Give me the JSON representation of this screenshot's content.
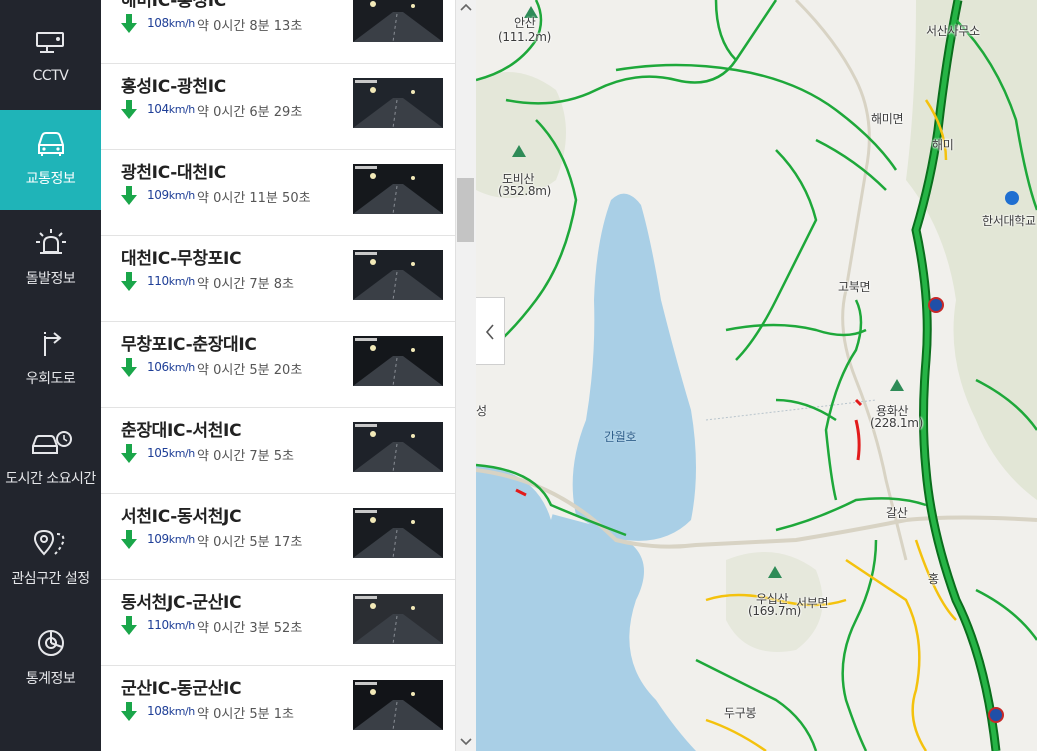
{
  "nav": {
    "items": [
      {
        "label": "CCTV",
        "icon": "cctv-icon",
        "active": false
      },
      {
        "label": "교통정보",
        "icon": "car-icon",
        "active": true
      },
      {
        "label": "돌발정보",
        "icon": "alert-siren-icon",
        "active": false
      },
      {
        "label": "우회도로",
        "icon": "detour-icon",
        "active": false
      },
      {
        "label": "도시간 소요시간",
        "icon": "car-clock-icon",
        "active": false
      },
      {
        "label": "관심구간 설정",
        "icon": "location-pin-icon",
        "active": false
      },
      {
        "label": "통계정보",
        "icon": "statistics-icon",
        "active": false
      }
    ]
  },
  "segments": [
    {
      "name": "해미IC-홍성IC",
      "speed": "108",
      "unit": "km/h",
      "time": "약 0시간 8분 13초"
    },
    {
      "name": "홍성IC-광천IC",
      "speed": "104",
      "unit": "km/h",
      "time": "약 0시간 6분 29초"
    },
    {
      "name": "광천IC-대천IC",
      "speed": "109",
      "unit": "km/h",
      "time": "약 0시간 11분 50초"
    },
    {
      "name": "대천IC-무창포IC",
      "speed": "110",
      "unit": "km/h",
      "time": "약 0시간 7분 8초"
    },
    {
      "name": "무창포IC-춘장대IC",
      "speed": "106",
      "unit": "km/h",
      "time": "약 0시간 5분 20초"
    },
    {
      "name": "춘장대IC-서천IC",
      "speed": "105",
      "unit": "km/h",
      "time": "약 0시간 7분 5초"
    },
    {
      "name": "서천IC-동서천JC",
      "speed": "109",
      "unit": "km/h",
      "time": "약 0시간 5분 17초"
    },
    {
      "name": "동서천JC-군산IC",
      "speed": "110",
      "unit": "km/h",
      "time": "약 0시간 3분 52초"
    },
    {
      "name": "군산IC-동군산IC",
      "speed": "108",
      "unit": "km/h",
      "time": "약 0시간 5분 1초"
    }
  ],
  "map": {
    "labels": {
      "ansan": "안산",
      "ansan_height": "(111.2m)",
      "dobisan": "도비산",
      "dobisan_height": "(352.8m)",
      "ganwolho": "간월호",
      "seosan_office": "서산사무소",
      "haemi": "해미면",
      "haemi2": "해미",
      "hanseo": "한서대학교",
      "gobuk": "고북면",
      "yonghwasan": "용화산",
      "yonghwasan_height": "(228.1m)",
      "galsan": "갈산",
      "usisan": "우십산",
      "usisan_height": "(169.7m)",
      "seobu": "서부면",
      "dugubong": "두구봉",
      "seong": "성",
      "hong": "홍"
    },
    "colors": {
      "water": "#a9cfe6",
      "road_green": "#1ea83a",
      "road_yellow": "#f4c20d",
      "road_red": "#e21b1b",
      "mountain": "#dfe5d2"
    }
  },
  "colors": {
    "nav_bg": "#22252d",
    "nav_active": "#1fb4b8",
    "speed_arrow": "#1aa64a",
    "speed_text": "#1f3f97"
  }
}
